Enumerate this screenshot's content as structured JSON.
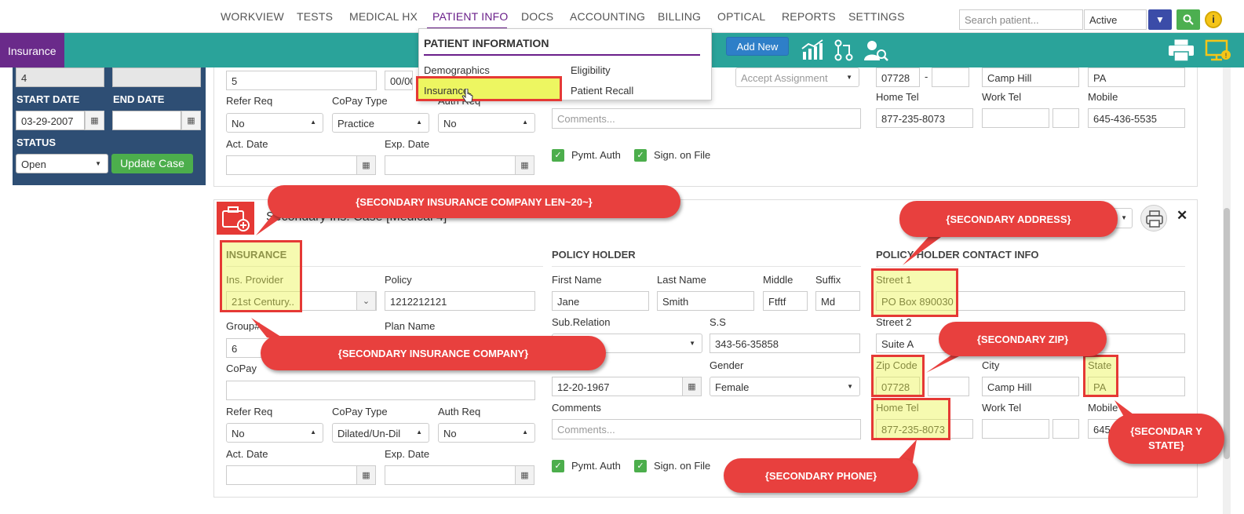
{
  "nav": {
    "items": [
      "WORKVIEW",
      "TESTS",
      "MEDICAL HX",
      "PATIENT INFO",
      "DOCS",
      "ACCOUNTING",
      "BILLING",
      "OPTICAL",
      "REPORTS",
      "SETTINGS"
    ],
    "active": "PATIENT INFO",
    "search_placeholder": "Search patient...",
    "status_value": "Active"
  },
  "toolbar": {
    "tab_label": "Insurance",
    "add_new_label": "Add New"
  },
  "menu": {
    "heading": "PATIENT INFORMATION",
    "items": [
      "Demographics",
      "Eligibility",
      "Insurance",
      "Patient Recall"
    ]
  },
  "left_panel": {
    "field1_value": "4",
    "start_date_label": "START DATE",
    "end_date_label": "END DATE",
    "start_date_value": "03-29-2007",
    "status_label": "STATUS",
    "status_value": "Open",
    "update_button": "Update Case"
  },
  "primary": {
    "field_value": "5",
    "field2_value": "00/00",
    "refer_req_label": "Refer Req",
    "refer_req_value": "No",
    "copay_type_label": "CoPay Type",
    "copay_type_value": "Practice",
    "auth_req_label": "Auth Req",
    "auth_req_value": "No",
    "act_date_label": "Act. Date",
    "exp_date_label": "Exp. Date",
    "accept_assignment": "Accept Assignment",
    "comments_label": "Comments",
    "comments_placeholder": "Comments...",
    "pymt_auth": "Pymt. Auth",
    "sign_on_file": "Sign. on File",
    "zip_value": "07728",
    "zip_dash": "-",
    "city_value": "Camp Hill",
    "state_value": "PA",
    "home_tel_label": "Home Tel",
    "work_tel_label": "Work Tel",
    "mobile_label": "Mobile",
    "home_tel_value": "877-235-8073",
    "mobile_value": "645-436-5535"
  },
  "secondary": {
    "title": "Secondary Ins. Case [Medical 4]",
    "insurance_heading": "INSURANCE",
    "ins_provider_label": "Ins. Provider",
    "ins_provider_value": "21st Century..",
    "policy_label": "Policy",
    "policy_value": "1212212121",
    "group_label": "Group#",
    "group_value": "6",
    "plan_name_label": "Plan Name",
    "copay_label": "CoPay",
    "refer_req_label": "Refer Req",
    "refer_req_value": "No",
    "copay_type_label": "CoPay Type",
    "copay_type_value": "Dilated/Un-Dil",
    "auth_req_label": "Auth Req",
    "auth_req_value": "No",
    "act_date_label": "Act. Date",
    "exp_date_label": "Exp. Date",
    "policy_holder_heading": "POLICY HOLDER",
    "first_name_label": "First Name",
    "first_name_value": "Jane",
    "last_name_label": "Last Name",
    "last_name_value": "Smith",
    "middle_label": "Middle",
    "middle_value": "Ftftf",
    "suffix_label": "Suffix",
    "suffix_value": "Md",
    "sub_relation_label": "Sub.Relation",
    "ss_label": "S.S",
    "ss_value": "343-56-35858",
    "dob_value": "12-20-1967",
    "gender_label": "Gender",
    "gender_value": "Female",
    "comments_label": "Comments",
    "comments_placeholder": "Comments...",
    "pymt_auth": "Pymt. Auth",
    "sign_on_file": "Sign. on File",
    "contact_heading": "POLICY HOLDER CONTACT INFO",
    "street1_label": "Street 1",
    "street1_value": "PO Box 890030",
    "street2_label": "Street 2",
    "street2_value": "Suite A",
    "zip_label": "Zip Code",
    "zip_value": "07728",
    "city_label": "City",
    "city_value": "Camp Hill",
    "state_label": "State",
    "state_value": "PA",
    "home_tel_label": "Home Tel",
    "home_tel_value": "877-235-8073",
    "work_tel_label": "Work Tel",
    "mobile_label": "Mobile",
    "mobile_value": "645"
  },
  "callouts": {
    "company_len": "{SECONDARY INSURANCE COMPANY LEN~20~}",
    "address": "{SECONDARY ADDRESS}",
    "company": "{SECONDARY INSURANCE COMPANY}",
    "zip": "{SECONDARY ZIP}",
    "state": "{SECONDAR Y STATE}",
    "phone": "{SECONDARY PHONE}"
  },
  "colors": {
    "teal": "#2aa39a",
    "purple": "#6a2a8a",
    "navy": "#2e4e74",
    "callout_red": "#e8403e",
    "highlight": "#ebf550"
  }
}
